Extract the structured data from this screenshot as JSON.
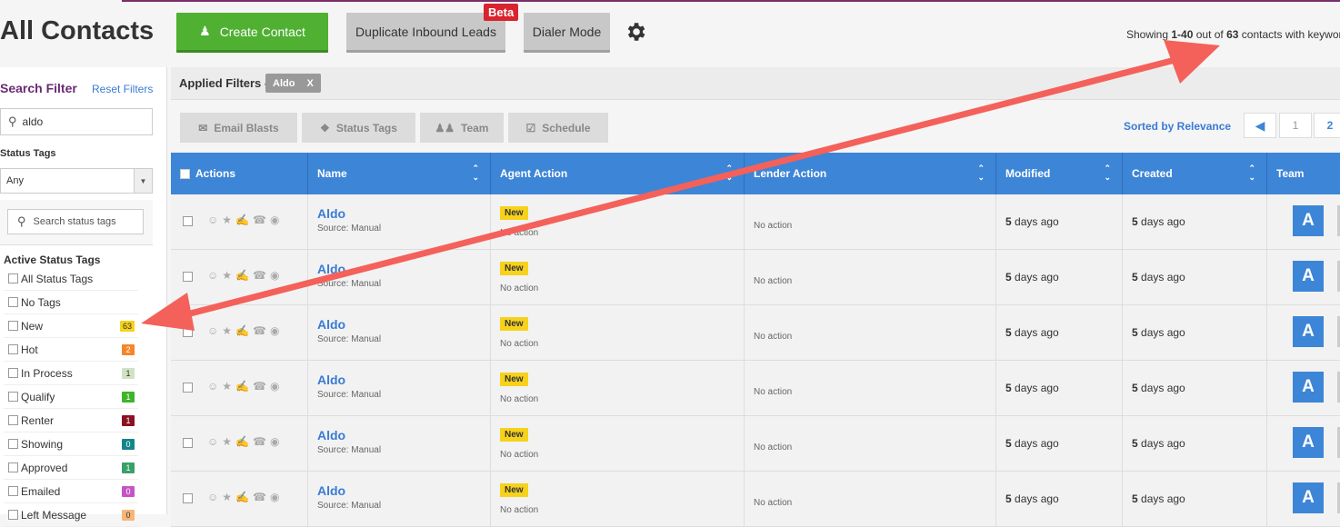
{
  "header": {
    "title": "All Contacts",
    "create_label": "Create Contact",
    "duplicate_label": "Duplicate Inbound Leads",
    "beta_label": "Beta",
    "dialer_label": "Dialer Mode",
    "showing_prefix": "Showing ",
    "showing_range": "1-40",
    "showing_mid": " out of ",
    "showing_total": "63",
    "showing_suffix": " contacts with keywor"
  },
  "sidebar": {
    "title": "Search Filter",
    "reset_label": "Reset Filters",
    "search_value": "aldo",
    "status_label": "Status Tags",
    "status_select": "Any",
    "tag_search_placeholder": "Search status tags",
    "active_title": "Active Status Tags",
    "tags": [
      {
        "label": "All Status Tags",
        "count": "",
        "bg": "",
        "fg": ""
      },
      {
        "label": "No Tags",
        "count": "",
        "bg": "",
        "fg": ""
      },
      {
        "label": "New",
        "count": "63",
        "bg": "#f6d21b",
        "fg": "#333"
      },
      {
        "label": "Hot",
        "count": "2",
        "bg": "#f5862a",
        "fg": "#fff"
      },
      {
        "label": "In Process",
        "count": "1",
        "bg": "#cfe3c4",
        "fg": "#333"
      },
      {
        "label": "Qualify",
        "count": "1",
        "bg": "#3fb52a",
        "fg": "#fff"
      },
      {
        "label": "Renter",
        "count": "1",
        "bg": "#8b1222",
        "fg": "#fff"
      },
      {
        "label": "Showing",
        "count": "0",
        "bg": "#12868a",
        "fg": "#fff"
      },
      {
        "label": "Approved",
        "count": "1",
        "bg": "#3aa06a",
        "fg": "#fff"
      },
      {
        "label": "Emailed",
        "count": "0",
        "bg": "#c455c6",
        "fg": "#fff"
      },
      {
        "label": "Left Message",
        "count": "0",
        "bg": "#f6b67a",
        "fg": "#333"
      }
    ]
  },
  "filters": {
    "applied_label": "Applied Filters -",
    "chip_label": "Aldo",
    "chip_close": "X"
  },
  "actions": {
    "email_label": "Email Blasts",
    "status_label": "Status Tags",
    "team_label": "Team",
    "schedule_label": "Schedule",
    "sorted_label": "Sorted by Relevance",
    "pages": [
      "1",
      "2"
    ]
  },
  "table": {
    "headers": {
      "actions": "Actions",
      "name": "Name",
      "agent": "Agent Action",
      "lender": "Lender Action",
      "modified": "Modified",
      "created": "Created",
      "team": "Team"
    },
    "rows": [
      {
        "name": "Aldo",
        "source": "Source: Manual",
        "tag": "New",
        "agent_action": "No action",
        "lender_action": "No action",
        "modified_num": "5",
        "modified_rest": " days ago",
        "created_num": "5",
        "created_rest": " days ago",
        "avatar": "A"
      },
      {
        "name": "Aldo",
        "source": "Source: Manual",
        "tag": "New",
        "agent_action": "No action",
        "lender_action": "No action",
        "modified_num": "5",
        "modified_rest": " days ago",
        "created_num": "5",
        "created_rest": " days ago",
        "avatar": "A"
      },
      {
        "name": "Aldo",
        "source": "Source: Manual",
        "tag": "New",
        "agent_action": "No action",
        "lender_action": "No action",
        "modified_num": "5",
        "modified_rest": " days ago",
        "created_num": "5",
        "created_rest": " days ago",
        "avatar": "A"
      },
      {
        "name": "Aldo",
        "source": "Source: Manual",
        "tag": "New",
        "agent_action": "No action",
        "lender_action": "No action",
        "modified_num": "5",
        "modified_rest": " days ago",
        "created_num": "5",
        "created_rest": " days ago",
        "avatar": "A"
      },
      {
        "name": "Aldo",
        "source": "Source: Manual",
        "tag": "New",
        "agent_action": "No action",
        "lender_action": "No action",
        "modified_num": "5",
        "modified_rest": " days ago",
        "created_num": "5",
        "created_rest": " days ago",
        "avatar": "A"
      },
      {
        "name": "Aldo",
        "source": "Source: Manual",
        "tag": "New",
        "agent_action": "No action",
        "lender_action": "No action",
        "modified_num": "5",
        "modified_rest": " days ago",
        "created_num": "5",
        "created_rest": " days ago",
        "avatar": "A"
      }
    ]
  },
  "colors": {
    "accent_blue": "#3d85d6",
    "create_green": "#4fb032",
    "annotation_arrow": "#f4615a"
  }
}
